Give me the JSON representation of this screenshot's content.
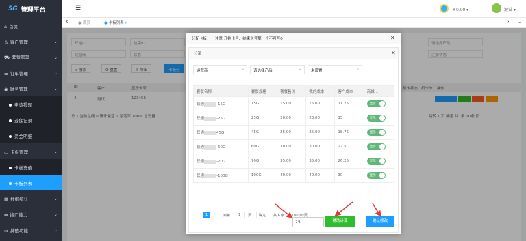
{
  "app": {
    "logo_mark": "5G",
    "title": "管理平台"
  },
  "sidebar": {
    "items": [
      {
        "label": "首页",
        "icon": "home-icon"
      },
      {
        "label": "客户管理",
        "icon": "user-icon"
      },
      {
        "label": "套餐管理",
        "icon": "cart-icon"
      },
      {
        "label": "订单管理",
        "icon": "order-icon"
      },
      {
        "label": "财务管理",
        "icon": "finance-icon"
      },
      {
        "label": "申请提现",
        "sub": true
      },
      {
        "label": "返佣记录",
        "sub": true
      },
      {
        "label": "资金明细",
        "sub": true
      },
      {
        "label": "卡板管理",
        "icon": "card-icon"
      },
      {
        "label": "卡板充值",
        "sub": true
      },
      {
        "label": "卡板列表",
        "sub": true,
        "active": true
      },
      {
        "label": "数据统计",
        "icon": "chart-icon"
      },
      {
        "label": "接口能力",
        "icon": "api-icon"
      },
      {
        "label": "其他功能",
        "icon": "other-icon"
      }
    ]
  },
  "header": {
    "money": "￥0.00",
    "user": "测试"
  },
  "tabs": {
    "home": "首页",
    "current": "卡板列表"
  },
  "filters": {
    "f1": "开始ID",
    "f2": "结束ID",
    "f3": "运营商",
    "f4": "状态",
    "f5": "请选择产品",
    "f6": "注册状态"
  },
  "toolbar": {
    "search": "搜索",
    "reset": "重置",
    "export": "导出",
    "assign": "卡板分"
  },
  "table_bg": {
    "headers": [
      "ID",
      "客户",
      "显示卡号",
      "",
      "",
      "",
      "",
      "",
      "",
      "",
      "",
      "",
      "",
      "",
      "",
      "机卡状态",
      "机卡分",
      "操作"
    ],
    "row": {
      "id": "4",
      "customer": "测试",
      "card": "123456"
    },
    "footer": "总 1  当前在网 0  累计激活 1  激活率 100%  总消量",
    "page_info": "跳转 1 页 确定 共1条 20条/页"
  },
  "dialog": {
    "title": "分配卡板",
    "notice": "注意 开始卡号、结束卡号第一位不可写0",
    "sub_title": "分润",
    "selects": {
      "operator": "运营商",
      "product": "请选择产品",
      "setting": "未设置"
    },
    "columns": [
      "套餐名称",
      "套餐规格",
      "套餐售价",
      "我的成本",
      "客户成本",
      "商城..."
    ],
    "rows": [
      {
        "name_prefix": "联通",
        "name_suffix": "-15G",
        "spec": "15G",
        "price": "15.00",
        "my_cost": "15.00",
        "cust_cost": "11.25",
        "status": "显示"
      },
      {
        "name_prefix": "联通",
        "name_suffix": "-25G",
        "spec": "25G",
        "price": "20.00",
        "my_cost": "20.00",
        "cust_cost": "15",
        "status": "显示"
      },
      {
        "name_prefix": "联通",
        "name_suffix": "45G",
        "spec": "45G",
        "price": "25.00",
        "my_cost": "25.00",
        "cust_cost": "18.75",
        "status": "显示"
      },
      {
        "name_prefix": "联通",
        "name_suffix": "-60G",
        "spec": "60G",
        "price": "30.00",
        "my_cost": "30.00",
        "cust_cost": "22.5",
        "status": "显示"
      },
      {
        "name_prefix": "联通",
        "name_suffix": "-70G",
        "spec": "70G",
        "price": "35.00",
        "my_cost": "35.00",
        "cust_cost": "26.25",
        "status": "显示"
      },
      {
        "name_prefix": "联通",
        "name_suffix": "-100G",
        "spec": "100G",
        "price": "40.00",
        "my_cost": "40.00",
        "cust_cost": "30",
        "status": "显示"
      }
    ],
    "pager": {
      "current": "1",
      "goto_label": "到第",
      "goto_value": "1",
      "page_unit": "页",
      "confirm": "确定",
      "total": "共 6 条",
      "per_page": "100 条/页"
    },
    "amount": "25",
    "calc_label": "辅助计算",
    "confirm_label": "确认修改"
  }
}
